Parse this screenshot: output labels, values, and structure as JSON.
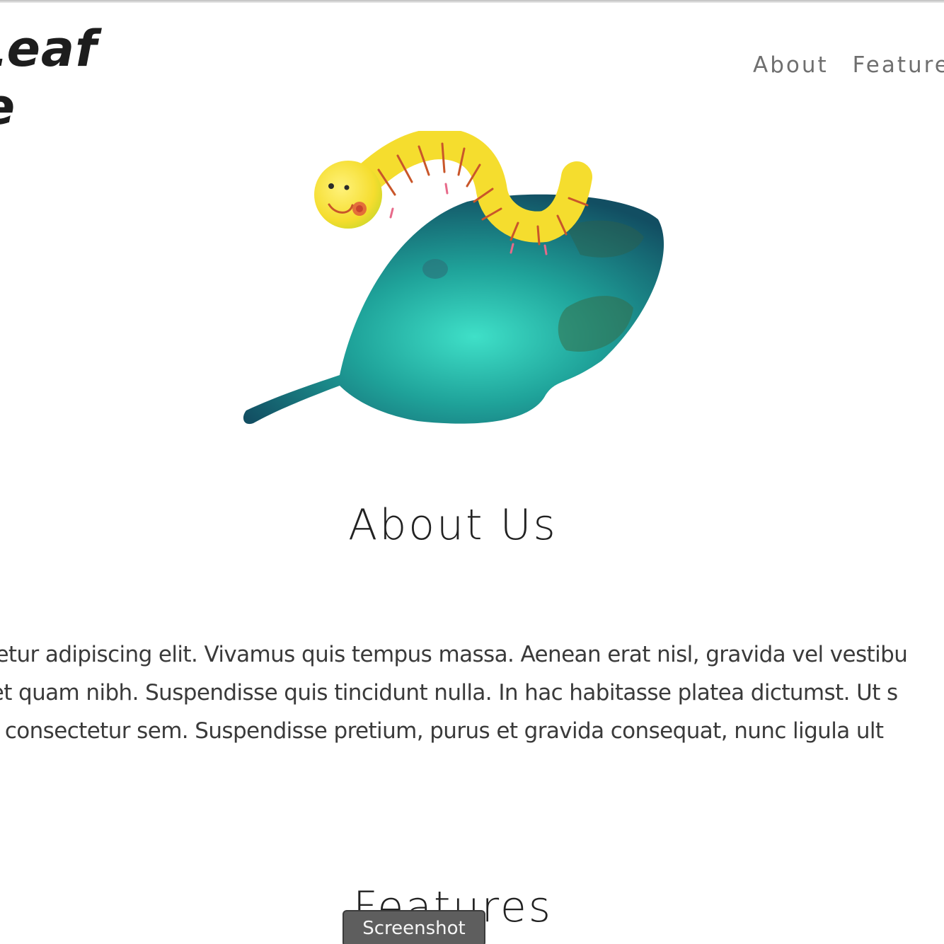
{
  "header": {
    "brand_line1": "e Leaf",
    "brand_line2": "are",
    "nav": [
      {
        "label": "About"
      },
      {
        "label": "Features"
      }
    ]
  },
  "about": {
    "title": "About Us",
    "lines": [
      "net, consectetur adipiscing elit. Vivamus quis tempus massa. Aenean erat nisl, gravida vel vestibu",
      ". Sed sit amet quam nibh. Suspendisse quis tincidunt nulla. In hac habitasse platea dictumst. Ut s",
      "ean sit amet consectetur sem. Suspendisse pretium, purus et gravida consequat, nunc ligula ult"
    ]
  },
  "features": {
    "title": "Features"
  },
  "overlay": {
    "screenshot_label": "Screenshot"
  },
  "colors": {
    "leaf": "#1fa39a",
    "caterpillar": "#f5dd2e",
    "stripes": "#c9562a",
    "nav_text": "#6f6f6f"
  }
}
